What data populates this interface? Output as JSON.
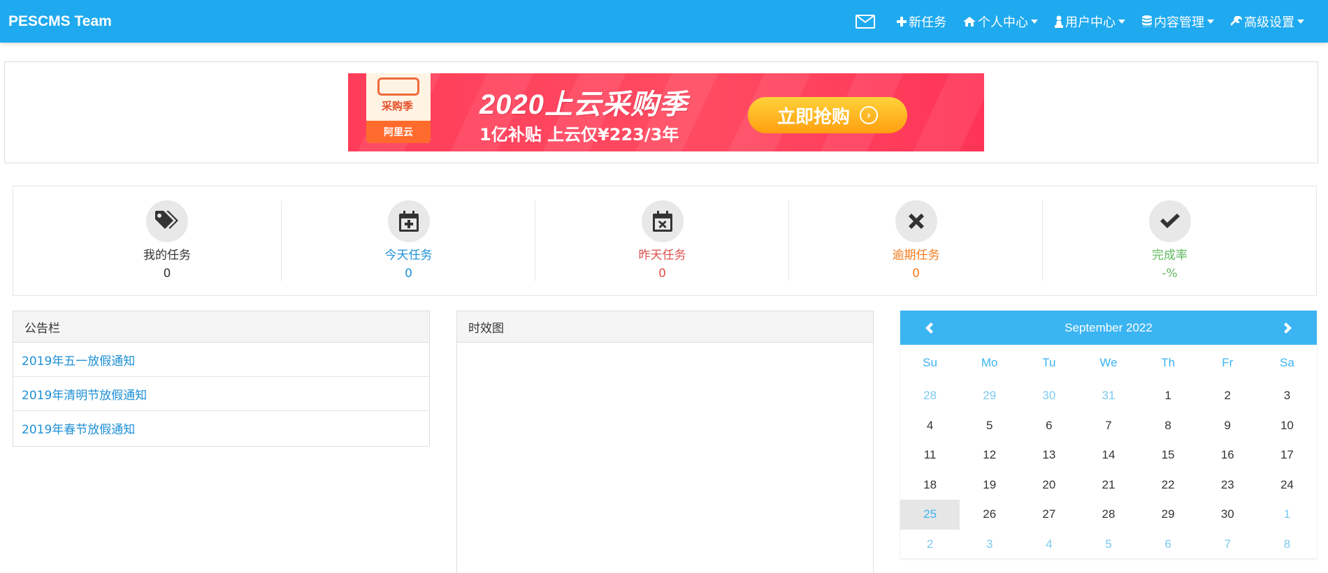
{
  "navbar": {
    "brand": "PESCMS Team",
    "items": [
      {
        "label": "新任务",
        "icon": "plus-icon"
      },
      {
        "label": "个人中心",
        "icon": "home-icon"
      },
      {
        "label": "用户中心",
        "icon": "user-icon"
      },
      {
        "label": "内容管理",
        "icon": "database-icon"
      },
      {
        "label": "高级设置",
        "icon": "wrench-icon"
      }
    ]
  },
  "banner": {
    "logo_text": "采购季",
    "logo_brand": "阿里云",
    "title": "2020上云采购季",
    "subtitle": "1亿补贴 上云仅¥223/3年",
    "button": "立即抢购"
  },
  "stats": [
    {
      "label": "我的任务",
      "value": "0",
      "color": "#333333",
      "icon": "tags-icon"
    },
    {
      "label": "今天任务",
      "value": "0",
      "color": "#1e90d6",
      "icon": "calendar-plus-icon"
    },
    {
      "label": "昨天任务",
      "value": "0",
      "color": "#dd514c",
      "icon": "calendar-times-icon"
    },
    {
      "label": "逾期任务",
      "value": "0",
      "color": "#f37b1d",
      "icon": "times-icon"
    },
    {
      "label": "完成率",
      "value": "-%",
      "color": "#5eb95e",
      "icon": "check-icon"
    }
  ],
  "notice": {
    "title": "公告栏",
    "items": [
      "2019年五一放假通知",
      "2019年清明节放假通知",
      "2019年春节放假通知"
    ]
  },
  "chart_panel": {
    "title": "时效图"
  },
  "calendar": {
    "title": "September 2022",
    "weekdays": [
      "Su",
      "Mo",
      "Tu",
      "We",
      "Th",
      "Fr",
      "Sa"
    ],
    "days": [
      {
        "d": "28",
        "m": true
      },
      {
        "d": "29",
        "m": true
      },
      {
        "d": "30",
        "m": true
      },
      {
        "d": "31",
        "m": true
      },
      {
        "d": "1"
      },
      {
        "d": "2"
      },
      {
        "d": "3"
      },
      {
        "d": "4"
      },
      {
        "d": "5"
      },
      {
        "d": "6"
      },
      {
        "d": "7"
      },
      {
        "d": "8"
      },
      {
        "d": "9"
      },
      {
        "d": "10"
      },
      {
        "d": "11"
      },
      {
        "d": "12"
      },
      {
        "d": "13"
      },
      {
        "d": "14"
      },
      {
        "d": "15"
      },
      {
        "d": "16"
      },
      {
        "d": "17"
      },
      {
        "d": "18"
      },
      {
        "d": "19"
      },
      {
        "d": "20"
      },
      {
        "d": "21"
      },
      {
        "d": "22"
      },
      {
        "d": "23"
      },
      {
        "d": "24"
      },
      {
        "d": "25",
        "today": true
      },
      {
        "d": "26"
      },
      {
        "d": "27"
      },
      {
        "d": "28"
      },
      {
        "d": "29"
      },
      {
        "d": "30"
      },
      {
        "d": "1",
        "m": true
      },
      {
        "d": "2",
        "m": true
      },
      {
        "d": "3",
        "m": true
      },
      {
        "d": "4",
        "m": true
      },
      {
        "d": "5",
        "m": true
      },
      {
        "d": "6",
        "m": true
      },
      {
        "d": "7",
        "m": true
      },
      {
        "d": "8",
        "m": true
      }
    ]
  }
}
